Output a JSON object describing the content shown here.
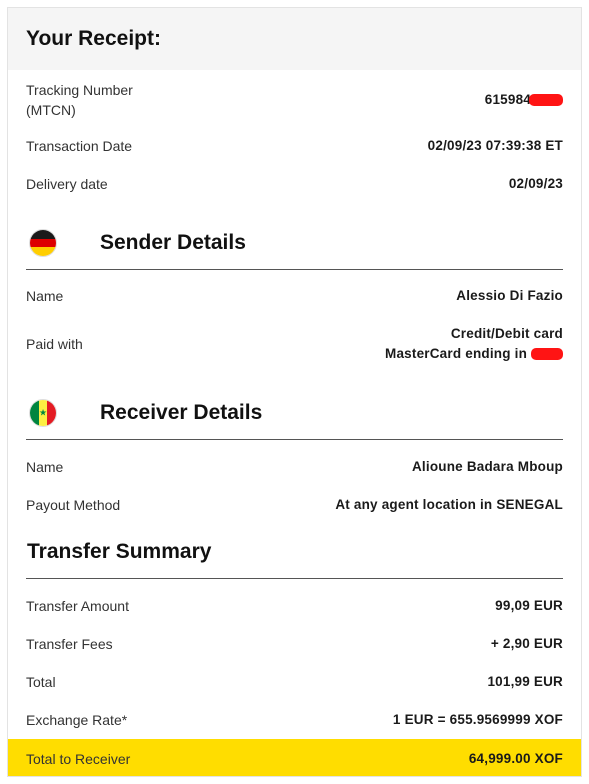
{
  "header": {
    "title": "Your Receipt:"
  },
  "receipt": {
    "tracking_label_1": "Tracking Number",
    "tracking_label_2": "(MTCN)",
    "tracking_value": "615984",
    "transaction_date_label": "Transaction Date",
    "transaction_date_value": "02/09/23 07:39:38 ET",
    "delivery_date_label": "Delivery date",
    "delivery_date_value": "02/09/23"
  },
  "sender": {
    "title": "Sender Details",
    "flag": "germany-flag-icon",
    "name_label": "Name",
    "name_value": "Alessio Di Fazio",
    "paid_with_label": "Paid with",
    "paid_with_line1": "Credit/Debit card",
    "paid_with_line2": "MasterCard ending in"
  },
  "receiver": {
    "title": "Receiver Details",
    "flag": "senegal-flag-icon",
    "name_label": "Name",
    "name_value": "Alioune Badara Mboup",
    "payout_label": "Payout Method",
    "payout_value": "At any agent location in SENEGAL"
  },
  "summary": {
    "title": "Transfer Summary",
    "amount_label": "Transfer Amount",
    "amount_value": "99,09 EUR",
    "fees_label": "Transfer Fees",
    "fees_value": "+ 2,90 EUR",
    "total_label": "Total",
    "total_value": "101,99 EUR",
    "rate_label": "Exchange Rate*",
    "rate_value": "1 EUR = 655.9569999 XOF",
    "receiver_total_label": "Total to Receiver",
    "receiver_total_value": "64,999.00 XOF"
  },
  "colors": {
    "highlight": "#ffdd00",
    "redaction": "#ff1414",
    "header_bg": "#f5f5f5"
  }
}
